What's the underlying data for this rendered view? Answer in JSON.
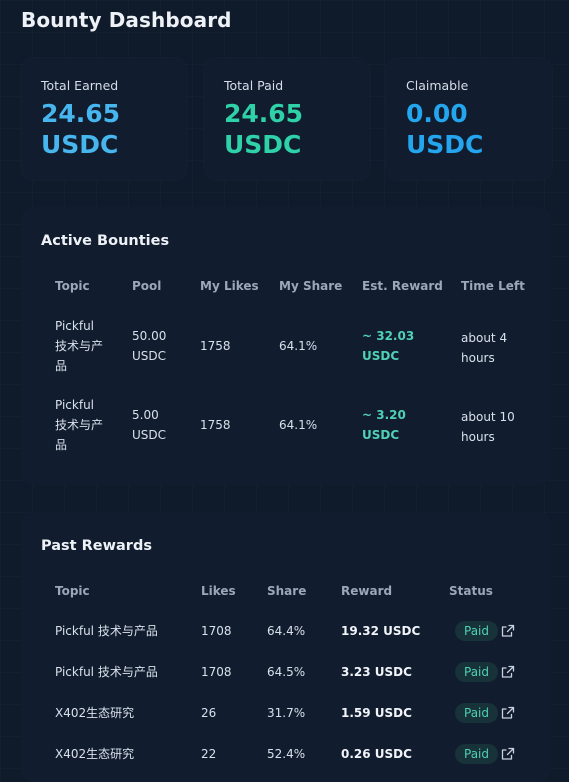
{
  "page": {
    "title": "Bounty Dashboard"
  },
  "stats": [
    {
      "label": "Total Earned",
      "value_line1": "24.65",
      "value_line2": "USDC",
      "color": "#47b6ee"
    },
    {
      "label": "Total Paid",
      "value_line1": "24.65",
      "value_line2": "USDC",
      "color": "#2fd1a8"
    },
    {
      "label": "Claimable",
      "value_line1": "0.00",
      "value_line2": "USDC",
      "color": "#23a6ee"
    }
  ],
  "active": {
    "title": "Active Bounties",
    "headers": [
      "Topic",
      "Pool",
      "My Likes",
      "My Share",
      "Est. Reward",
      "Time Left"
    ],
    "rows": [
      {
        "topic": [
          "Pickful",
          "技术与产",
          "品"
        ],
        "pool": [
          "50.00",
          "USDC"
        ],
        "likes": "1758",
        "share": "64.1%",
        "reward": [
          "~ 32.03",
          "USDC"
        ],
        "time": [
          "about 4",
          "hours"
        ]
      },
      {
        "topic": [
          "Pickful",
          "技术与产",
          "品"
        ],
        "pool": [
          "5.00",
          "USDC"
        ],
        "likes": "1758",
        "share": "64.1%",
        "reward": [
          "~ 3.20",
          "USDC"
        ],
        "time": [
          "about 10",
          "hours"
        ]
      }
    ]
  },
  "past": {
    "title": "Past Rewards",
    "headers": [
      "Topic",
      "Likes",
      "Share",
      "Reward",
      "Status"
    ],
    "rows": [
      {
        "topic": "Pickful 技术与产品",
        "likes": "1708",
        "share": "64.4%",
        "reward": "19.32 USDC",
        "status": "Paid",
        "link_icon": "external-link-icon"
      },
      {
        "topic": "Pickful 技术与产品",
        "likes": "1708",
        "share": "64.5%",
        "reward": "3.23 USDC",
        "status": "Paid",
        "link_icon": "external-link-icon"
      },
      {
        "topic": "X402生态研究",
        "likes": "26",
        "share": "31.7%",
        "reward": "1.59 USDC",
        "status": "Paid",
        "link_icon": "external-link-icon"
      },
      {
        "topic": "X402生态研究",
        "likes": "22",
        "share": "52.4%",
        "reward": "0.26 USDC",
        "status": "Paid",
        "link_icon": "external-link-icon"
      }
    ]
  }
}
